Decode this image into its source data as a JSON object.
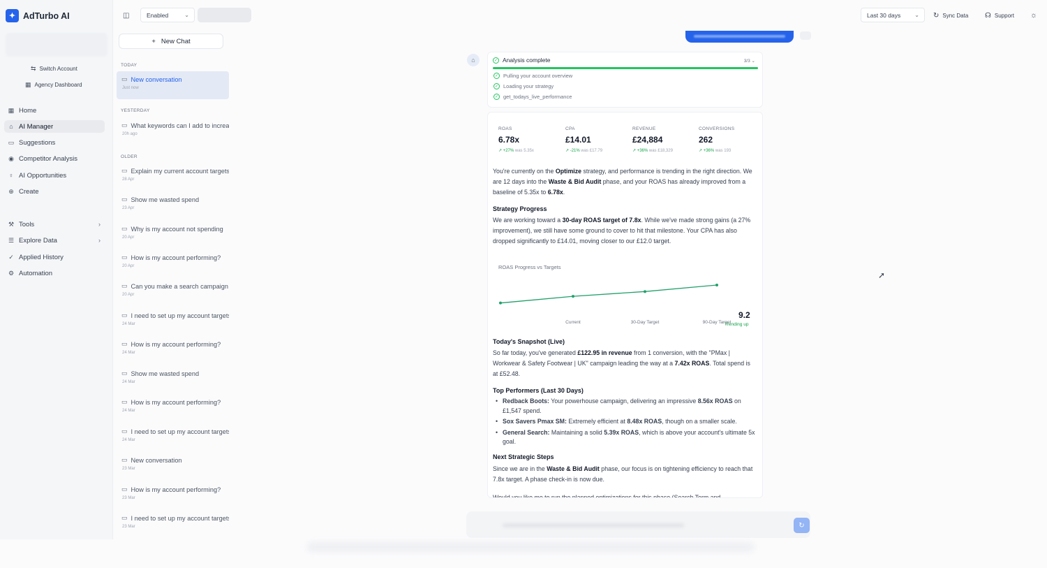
{
  "brand": {
    "name": "AdTurbo AI",
    "logo_icon": "sparkle-icon"
  },
  "account": {
    "switch_label": "Switch Account",
    "agency_label": "Agency Dashboard"
  },
  "nav": [
    {
      "label": "Home",
      "icon": "grid-icon"
    },
    {
      "label": "AI Manager",
      "icon": "robot-icon",
      "active": true
    },
    {
      "label": "Suggestions",
      "icon": "message-icon"
    },
    {
      "label": "Competitor Analysis",
      "icon": "eye-icon"
    },
    {
      "label": "AI Opportunities",
      "icon": "lightbulb-icon"
    },
    {
      "label": "Create",
      "icon": "plus-circle-icon"
    },
    {
      "label": "Tools",
      "icon": "wrench-icon",
      "chevron": true
    },
    {
      "label": "Explore Data",
      "icon": "database-icon",
      "chevron": true
    },
    {
      "label": "Applied History",
      "icon": "check-icon"
    },
    {
      "label": "Automation",
      "icon": "gear-icon"
    }
  ],
  "topbar": {
    "status_select": "Enabled",
    "date_range": "Last 30 days",
    "sync_label": "Sync Data",
    "support_label": "Support"
  },
  "conversations": {
    "new_chat_label": "New Chat",
    "sections": {
      "today": "TODAY",
      "yesterday": "YESTERDAY",
      "older": "OLDER"
    },
    "items": [
      {
        "title": "New conversation",
        "date": "Just now",
        "active": true
      },
      {
        "title": "What keywords can I add to increase",
        "date": "20h ago"
      },
      {
        "title": "Explain my current account targets",
        "date": "28 Apr"
      },
      {
        "title": "Show me wasted spend",
        "date": "23 Apr"
      },
      {
        "title": "Why is my account not spending",
        "date": "20 Apr"
      },
      {
        "title": "How is my account performing?",
        "date": "20 Apr"
      },
      {
        "title": "Can you make a search campaign",
        "date": "20 Apr"
      },
      {
        "title": "I need to set up my account targets",
        "date": "24 Mar"
      },
      {
        "title": "How is my account performing?",
        "date": "24 Mar"
      },
      {
        "title": "Show me wasted spend",
        "date": "24 Mar"
      },
      {
        "title": "How is my account performing?",
        "date": "24 Mar"
      },
      {
        "title": "I need to set up my account targets",
        "date": "24 Mar"
      },
      {
        "title": "New conversation",
        "date": "23 Mar"
      },
      {
        "title": "How is my account performing?",
        "date": "23 Mar"
      },
      {
        "title": "I need to set up my account targets",
        "date": "23 Mar"
      }
    ]
  },
  "analysis": {
    "title": "Analysis complete",
    "count": "3/3",
    "steps": [
      "Pulling your account overview",
      "Loading your strategy",
      "get_todays_live_performance"
    ]
  },
  "metrics": [
    {
      "label": "ROAS",
      "value": "6.78x",
      "change": "+27%",
      "was": "was 5.35x"
    },
    {
      "label": "CPA",
      "value": "£14.01",
      "change": "-21%",
      "was": "was £17.79"
    },
    {
      "label": "REVENUE",
      "value": "£24,884",
      "change": "+36%",
      "was": "was £18,329"
    },
    {
      "label": "CONVERSIONS",
      "value": "262",
      "change": "+36%",
      "was": "was 193"
    }
  ],
  "message": {
    "intro": "You're currently on the <b>Optimize</b> strategy, and performance is trending in the right direction. We are 12 days into the <b>Waste &amp; Bid Audit</b> phase, and your ROAS has already improved from a baseline of 5.35x to <b>6.78x</b>.",
    "strategy_heading": "Strategy Progress",
    "strategy_text": "We are working toward a <b>30-day ROAS target of 7.8x</b>. While we've made strong gains (a 27% improvement), we still have some ground to cover to hit that milestone. Your CPA has also dropped significantly to £14.01, moving closer to our £12.0 target.",
    "snapshot_heading": "Today's Snapshot (Live)",
    "snapshot_text": "So far today, you've generated <b>£122.95 in revenue</b> from 1 conversion, with the \"PMax | Workwear &amp; Safety Footwear | UK\" campaign leading the way at a <b>7.42x ROAS</b>. Total spend is at £52.48.",
    "top_heading": "Top Performers (Last 30 Days)",
    "top_items": [
      "<b>Redback Boots:</b> Your powerhouse campaign, delivering an impressive <b>8.56x ROAS</b> on £1,547 spend.",
      "<b>Sox Savers Pmax SM:</b> Extremely efficient at <b>8.48x ROAS</b>, though on a smaller scale.",
      "<b>General Search:</b> Maintaining a solid <b>5.39x ROAS</b>, which is above your account's ultimate 5x goal."
    ],
    "next_heading": "Next Strategic Steps",
    "next_text": "Since we are in the <b>Waste &amp; Bid Audit</b> phase, our focus is on tightening efficiency to reach that 7.8x target. A phase check-in is now due.",
    "cutoff_text": "Would you like me to run the planned optimizations for this phase (Search Term and"
  },
  "chart_data": {
    "type": "line",
    "title": "ROAS Progress vs Targets",
    "categories": [
      "",
      "Current",
      "30-Day Target",
      "90-Day Target"
    ],
    "series": [
      {
        "values": [
          5.35,
          6.78,
          7.8,
          9.2
        ]
      }
    ],
    "end_value_label": "9.2",
    "trend_label": "Trending up",
    "color": "#22a06b"
  },
  "colors": {
    "accent": "#2563eb",
    "success": "#22c55e"
  }
}
